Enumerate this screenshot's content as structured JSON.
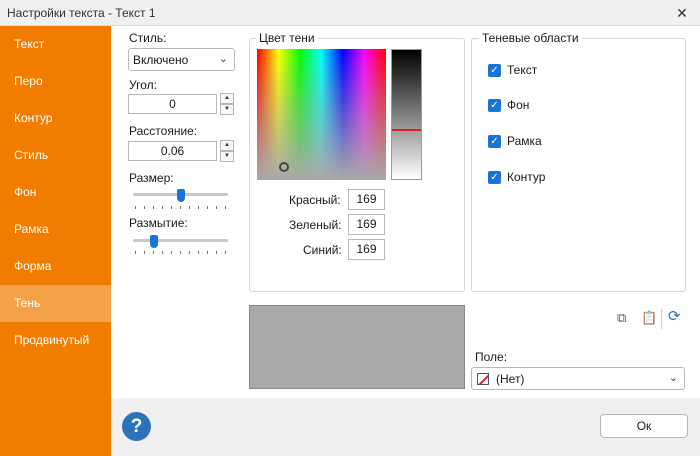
{
  "window": {
    "title": "Настройки текста - Текст 1",
    "close_glyph": "✕"
  },
  "sidebar": {
    "items": [
      {
        "label": "Текст"
      },
      {
        "label": "Перо"
      },
      {
        "label": "Контур"
      },
      {
        "label": "Стиль"
      },
      {
        "label": "Фон"
      },
      {
        "label": "Рамка"
      },
      {
        "label": "Форма"
      },
      {
        "label": "Тень",
        "active": true
      },
      {
        "label": "Продвинутый"
      }
    ]
  },
  "style": {
    "label": "Стиль:",
    "value": "Включено"
  },
  "angle": {
    "label": "Угол:",
    "value": "0"
  },
  "distance": {
    "label": "Расстояние:",
    "value": "0.06"
  },
  "size": {
    "label": "Размер:",
    "level": 0.5
  },
  "blur": {
    "label": "Размытие:",
    "level": 0.2
  },
  "shadow_color": {
    "title": "Цвет тени",
    "red_label": "Красный:",
    "red": "169",
    "green_label": "Зеленый:",
    "green": "169",
    "blue_label": "Синий:",
    "blue": "169",
    "color": "#a9a9a9"
  },
  "shadow_areas": {
    "title": "Теневые области",
    "items": [
      {
        "label": "Текст",
        "checked": true
      },
      {
        "label": "Фон",
        "checked": true
      },
      {
        "label": "Рамка",
        "checked": true
      },
      {
        "label": "Контур",
        "checked": true
      }
    ]
  },
  "toolbar": {
    "copy_icon": "copy-icon",
    "paste_icon": "paste-icon",
    "reset_icon": "reset-icon"
  },
  "field": {
    "label": "Поле:",
    "value": "(Нет)"
  },
  "buttons": {
    "ok": "Ок",
    "help": "?"
  },
  "colors": {
    "accent": "#f27c00",
    "active_item": "#f5a14a",
    "control_blue": "#1a73d6"
  }
}
